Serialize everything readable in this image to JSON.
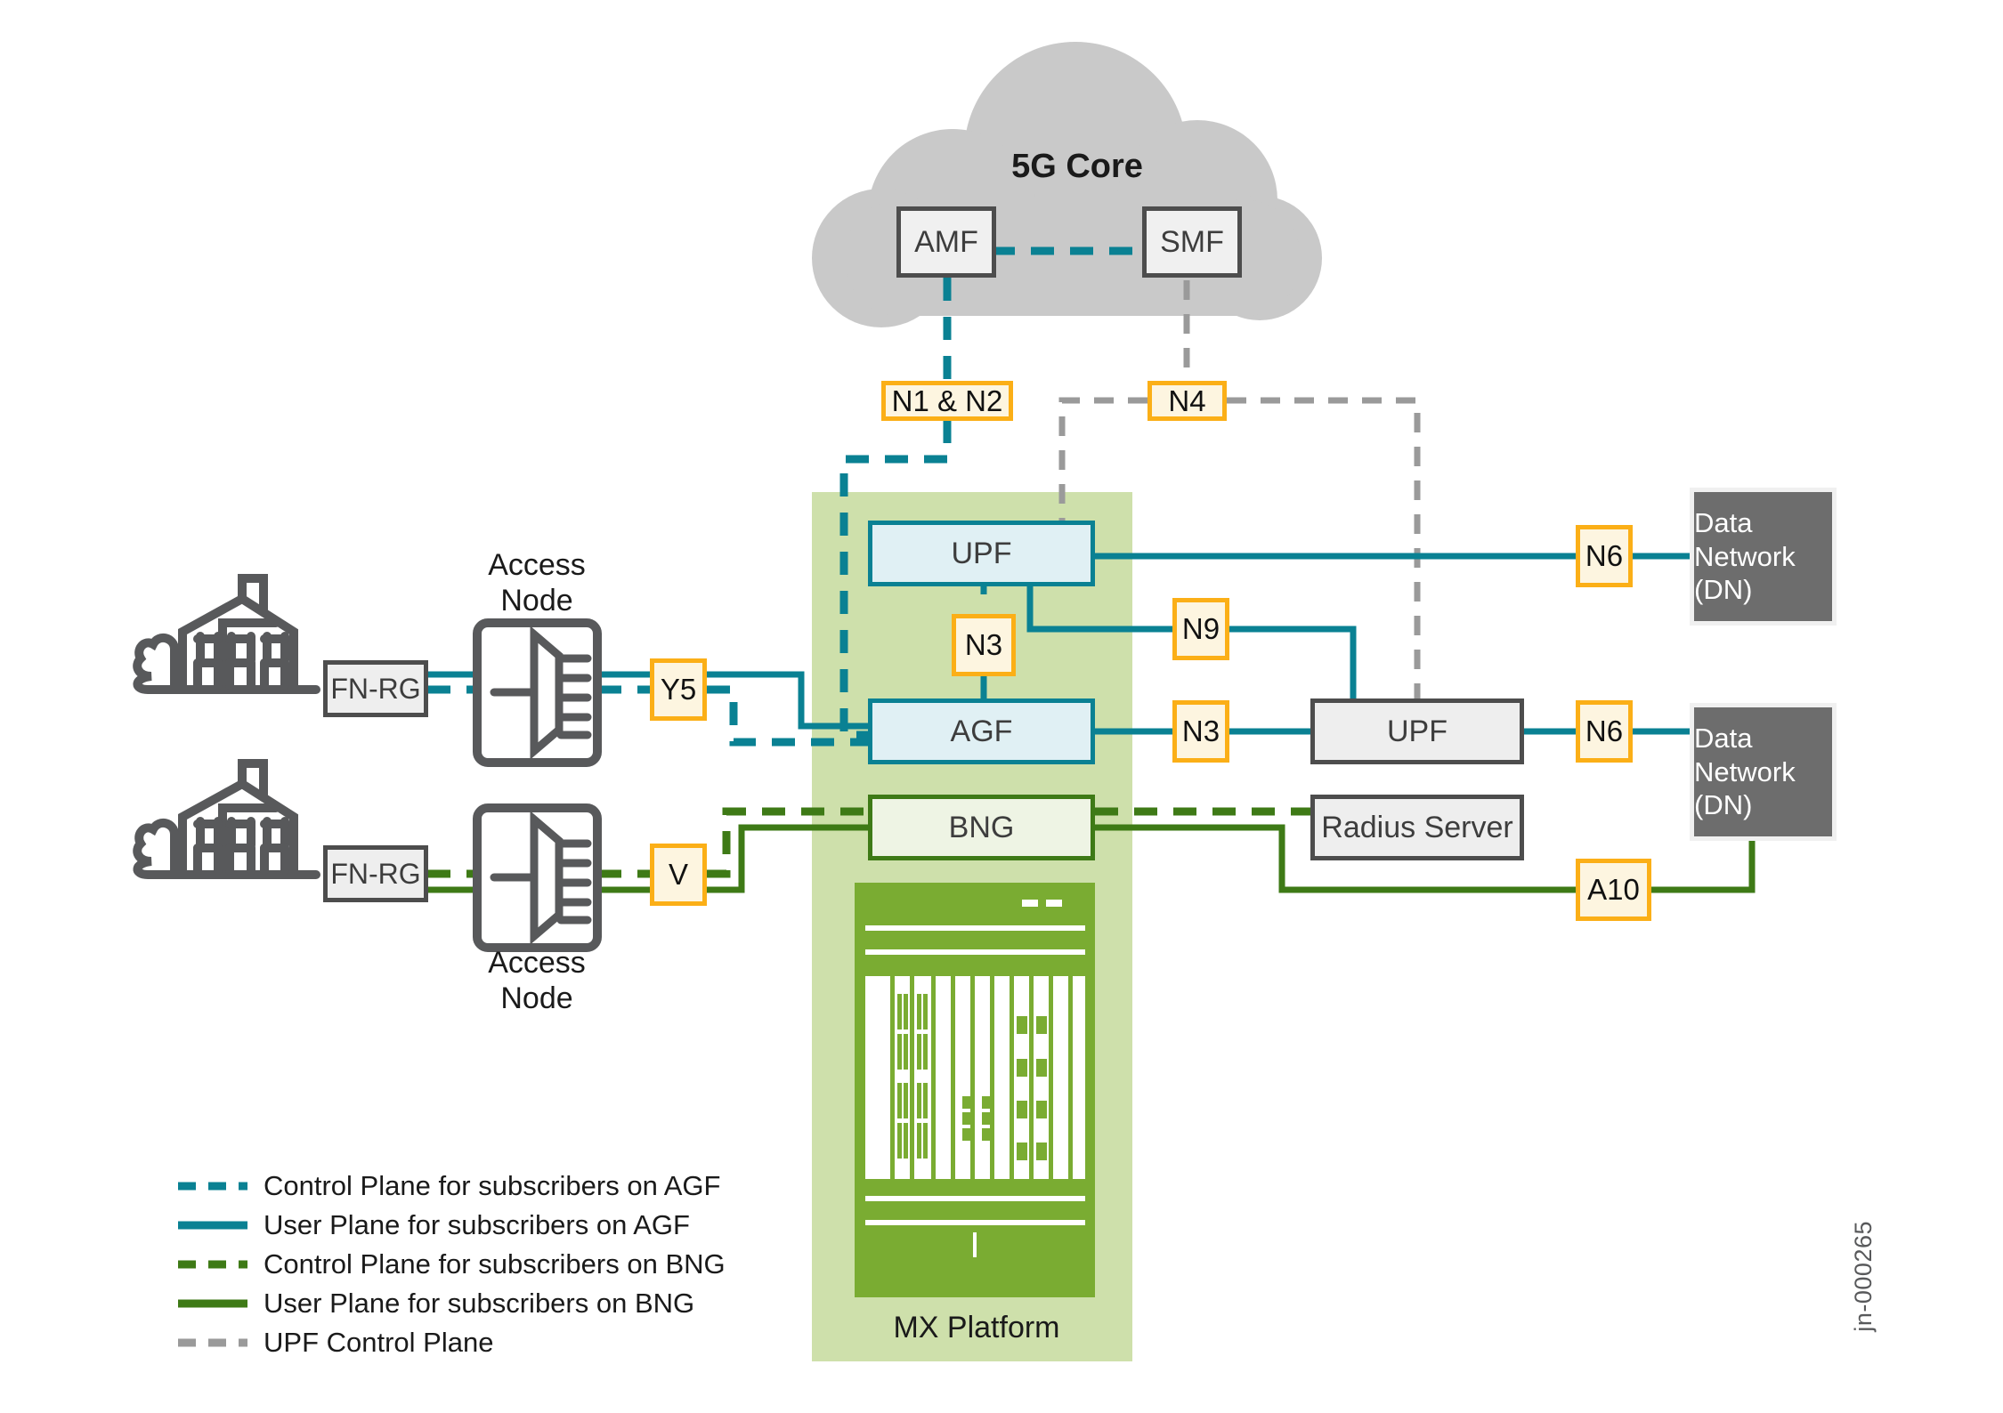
{
  "diagram": {
    "watermark": "jn-000265",
    "colors": {
      "teal": "#0a8193",
      "green": "#3e7a16",
      "gray_dash": "#9a9a9a",
      "orange_border": "#fbaf17",
      "orange_fill": "#fdf5e0",
      "band_green": "#cee0ab",
      "chassis_green": "#7aac32",
      "dn_gray": "#6d6d6d",
      "cloud_gray": "#c9c9c9"
    }
  },
  "cloud": {
    "title": "5G Core",
    "nodes": [
      {
        "id": "amf",
        "label": "AMF"
      },
      {
        "id": "smf",
        "label": "SMF"
      }
    ]
  },
  "interfaces": [
    {
      "id": "n1n2",
      "label": "N1 & N2"
    },
    {
      "id": "n4",
      "label": "N4"
    },
    {
      "id": "n3a",
      "label": "N3"
    },
    {
      "id": "n9",
      "label": "N9"
    },
    {
      "id": "n3b",
      "label": "N3"
    },
    {
      "id": "n6a",
      "label": "N6"
    },
    {
      "id": "n6b",
      "label": "N6"
    },
    {
      "id": "y5",
      "label": "Y5"
    },
    {
      "id": "v",
      "label": "V"
    },
    {
      "id": "a10",
      "label": "A10"
    }
  ],
  "mx_platform": {
    "functions": [
      {
        "id": "upf",
        "label": "UPF"
      },
      {
        "id": "agf",
        "label": "AGF"
      },
      {
        "id": "bng",
        "label": "BNG"
      }
    ],
    "caption": "MX Platform"
  },
  "access": {
    "top": {
      "cpe_label": "FN-RG",
      "node_label": "Access\nNode"
    },
    "bottom": {
      "cpe_label": "FN-RG",
      "node_label": "Access\nNode"
    }
  },
  "external": [
    {
      "id": "upf_ext",
      "label": "UPF"
    },
    {
      "id": "radius",
      "label": "Radius Server"
    },
    {
      "id": "dn_top",
      "label": "Data\nNetwork\n(DN)"
    },
    {
      "id": "dn_bottom",
      "label": "Data\nNetwork\n(DN)"
    }
  ],
  "legend": {
    "items": [
      {
        "label": "Control Plane for subscribers on AGF",
        "color": "#0a8193",
        "style": "dashed"
      },
      {
        "label": "User Plane for subscribers on AGF",
        "color": "#0a8193",
        "style": "solid"
      },
      {
        "label": "Control Plane for subscribers on BNG",
        "color": "#3e7a16",
        "style": "dashed"
      },
      {
        "label": "User Plane for subscribers on BNG",
        "color": "#3e7a16",
        "style": "solid"
      },
      {
        "label": "UPF Control Plane",
        "color": "#9a9a9a",
        "style": "dashed"
      }
    ]
  }
}
